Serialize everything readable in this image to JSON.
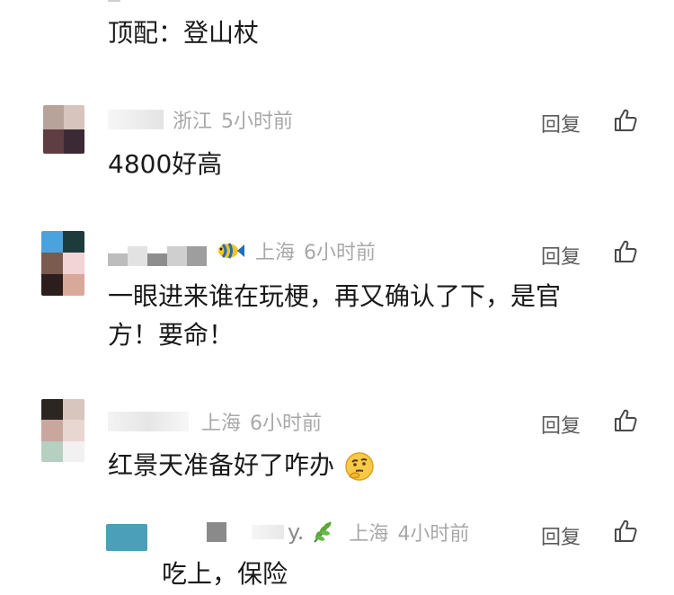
{
  "comments": [
    {
      "text": "顶配：登山杖"
    },
    {
      "location": "浙江",
      "time": "5小时前",
      "reply_label": "回复",
      "text": "4800好高"
    },
    {
      "location": "上海",
      "time": "6小时前",
      "reply_label": "回复",
      "text_line1": "一眼进来谁在玩梗，再又确认了下，是官",
      "text_line2": "方！要命！",
      "badge_icon": "fish-icon"
    },
    {
      "location": "上海",
      "time": "6小时前",
      "reply_label": "回复",
      "text": "红景天准备好了咋办",
      "emoji_icon": "thinking-face-icon"
    },
    {
      "name_tail": "y.",
      "location": "上海",
      "time": "4小时前",
      "reply_label": "回复",
      "text": "吃上，保险",
      "badge_icon": "leaf-sprig-icon"
    }
  ],
  "icons": {
    "like": "thumbs-up-icon"
  },
  "colors": {
    "meta_gray": "#a8a8a8",
    "reply_gray": "#5a5a5a",
    "text_dark": "#1a1a1a"
  }
}
